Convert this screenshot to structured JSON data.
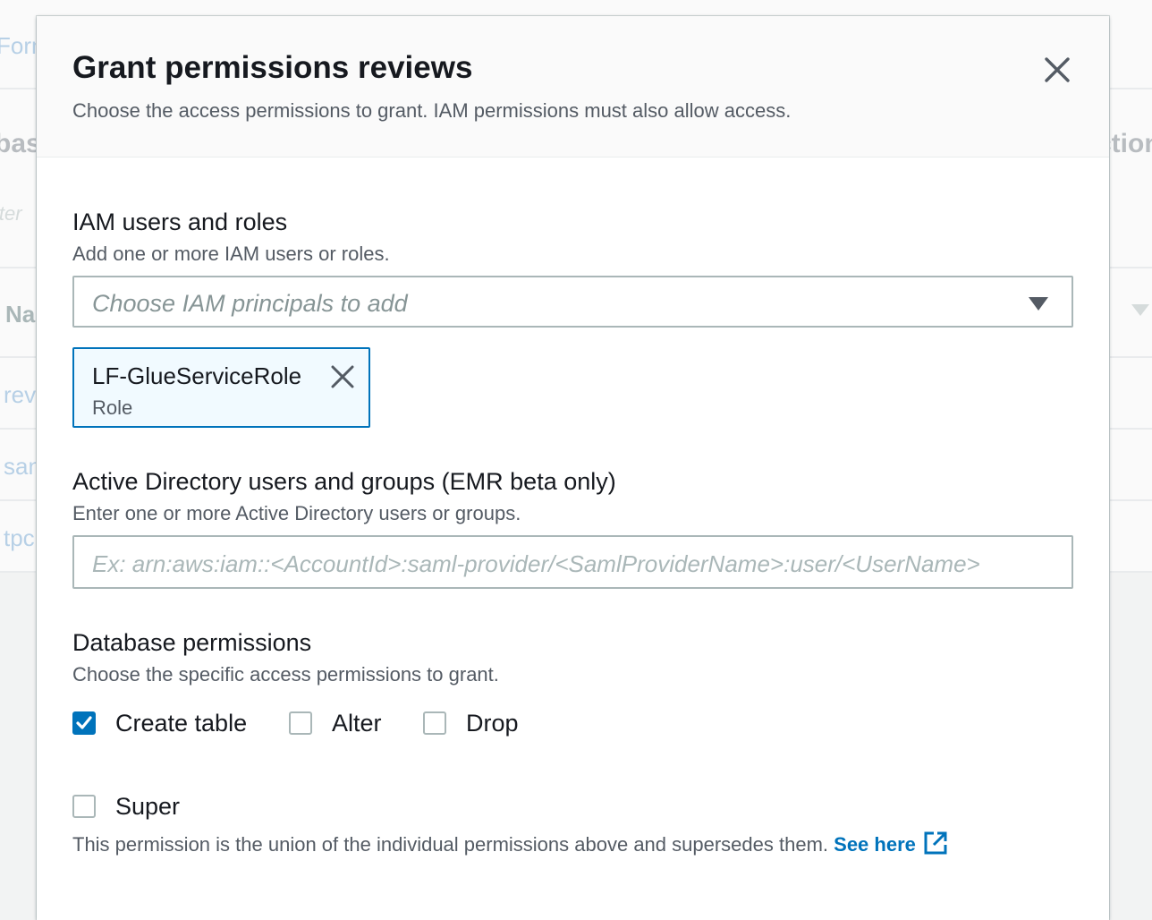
{
  "background": {
    "fragments": {
      "top_link": "Forma",
      "heading": "base",
      "right_heading": "ction",
      "filter": "iter",
      "col_name": "Na",
      "row1": "rev",
      "row2": "san",
      "row3": "tpc"
    }
  },
  "modal": {
    "title": "Grant permissions reviews",
    "subtitle": "Choose the access permissions to grant. IAM permissions must also allow access.",
    "close_icon": "close-icon"
  },
  "iam": {
    "label": "IAM users and roles",
    "description": "Add one or more IAM users or roles.",
    "placeholder": "Choose IAM principals to add",
    "selected": [
      {
        "name": "LF-GlueServiceRole",
        "type": "Role"
      }
    ]
  },
  "active_directory": {
    "label": "Active Directory users and groups (EMR beta only)",
    "description": "Enter one or more Active Directory users or groups.",
    "placeholder": "Ex: arn:aws:iam::<AccountId>:saml-provider/<SamlProviderName>:user/<UserName>"
  },
  "database_permissions": {
    "label": "Database permissions",
    "description": "Choose the specific access permissions to grant.",
    "options": [
      {
        "label": "Create table",
        "checked": true
      },
      {
        "label": "Alter",
        "checked": false
      },
      {
        "label": "Drop",
        "checked": false
      }
    ],
    "super": {
      "label": "Super",
      "checked": false,
      "note": "This permission is the union of the individual permissions above and supersedes them.",
      "link_label": "See here",
      "link_icon": "external-link-icon"
    }
  },
  "colors": {
    "accent": "#0073bb",
    "token_bg": "#f1faff",
    "border": "#aab7b8"
  }
}
